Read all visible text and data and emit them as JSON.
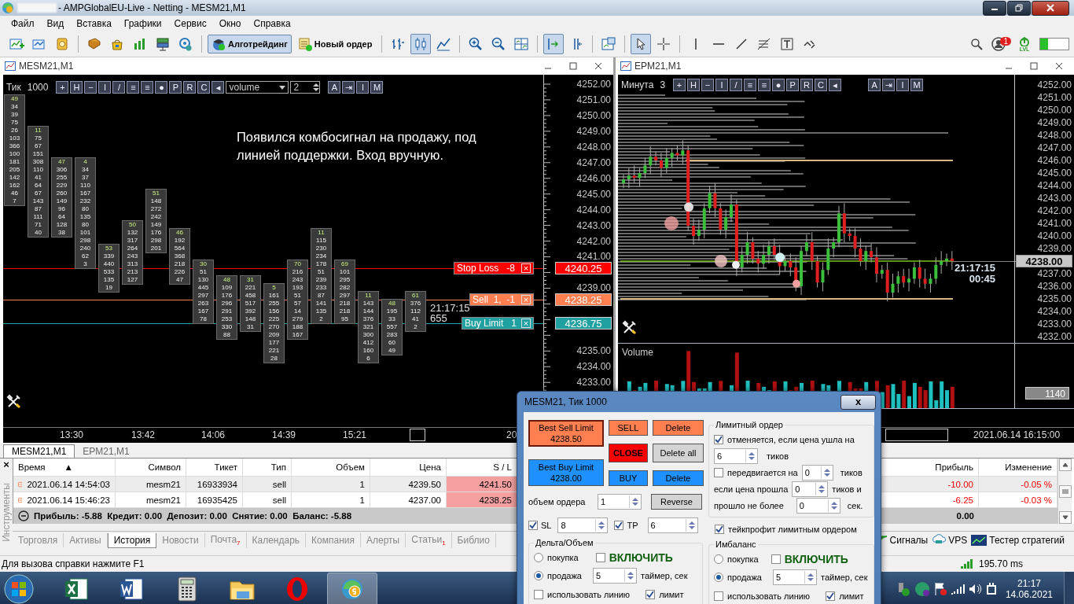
{
  "window": {
    "title": "- AMPGlobalEU-Live - Netting - MESM21,M1"
  },
  "menu": [
    "Файл",
    "Вид",
    "Вставка",
    "Графики",
    "Сервис",
    "Окно",
    "Справка"
  ],
  "toolbar": [
    {
      "kind": "new-chart",
      "selected": false
    },
    {
      "kind": "profiles",
      "selected": false
    },
    {
      "kind": "money",
      "selected": false
    },
    {
      "kind": "sep"
    },
    {
      "kind": "library",
      "selected": false
    },
    {
      "kind": "market",
      "selected": false
    },
    {
      "kind": "signals",
      "selected": false
    },
    {
      "kind": "server",
      "selected": false
    },
    {
      "kind": "radar",
      "selected": false
    },
    {
      "kind": "sep"
    },
    {
      "kind": "algo",
      "label": "Алготрейдинг",
      "selected": true
    },
    {
      "kind": "order",
      "label": "Новый ордер",
      "selected": false
    },
    {
      "kind": "sep"
    },
    {
      "kind": "bars",
      "selected": false
    },
    {
      "kind": "candles",
      "selected": true
    },
    {
      "kind": "line",
      "selected": false
    },
    {
      "kind": "sep"
    },
    {
      "kind": "zoom-in",
      "selected": false
    },
    {
      "kind": "zoom-out",
      "selected": false
    },
    {
      "kind": "tile",
      "selected": false
    },
    {
      "kind": "sep"
    },
    {
      "kind": "autoscroll",
      "selected": true
    },
    {
      "kind": "shift",
      "selected": false
    },
    {
      "kind": "sep"
    },
    {
      "kind": "template",
      "selected": false
    },
    {
      "kind": "sep"
    },
    {
      "kind": "cursor",
      "selected": true
    },
    {
      "kind": "crosshair",
      "selected": false
    },
    {
      "kind": "sep"
    },
    {
      "kind": "vline",
      "selected": false
    },
    {
      "kind": "hline",
      "selected": false
    },
    {
      "kind": "trend",
      "selected": false
    },
    {
      "kind": "fibo",
      "selected": false
    },
    {
      "kind": "text",
      "selected": false
    },
    {
      "kind": "shapes",
      "selected": false
    }
  ],
  "toolbar_right": {
    "badge": "1",
    "lvl": "LVL"
  },
  "left_chart": {
    "title": "MESM21,M1",
    "period": "Тик",
    "period_value": "1000",
    "tools": [
      "+",
      "H",
      "−",
      "I",
      "/",
      "≡",
      "≡",
      "●",
      "P",
      "R",
      "C",
      "◂"
    ],
    "indicator": "volume",
    "indicator_value": "2",
    "tools2": [
      "A",
      "⇥",
      "I",
      "M"
    ],
    "annotation": "Появился комбосигнал на продажу, под линией поддержки. Вход вручную.",
    "prices": [
      "4252.00",
      "4251.00",
      "4250.00",
      "4249.00",
      "4248.00",
      "4247.00",
      "4246.00",
      "4245.00",
      "4244.00",
      "4243.00",
      "4242.00",
      "4241.00",
      "4239.00",
      "4235.00",
      "4234.00",
      "4233.00"
    ],
    "clusters": [
      [
        "49",
        "34",
        "39",
        "75",
        "26",
        "103",
        "366",
        "100",
        "181",
        "205",
        "142",
        "162",
        "46",
        "7"
      ],
      [
        "11",
        "75",
        "67",
        "151",
        "308",
        "110",
        "41",
        "64",
        "67",
        "143",
        "87",
        "111",
        "71",
        "40"
      ],
      [
        "47",
        "306",
        "255",
        "229",
        "260",
        "149",
        "96",
        "64",
        "128",
        "38"
      ],
      [
        "4",
        "34",
        "37",
        "110",
        "167",
        "232",
        "80",
        "135",
        "80",
        "101",
        "298",
        "240",
        "62",
        "3"
      ],
      [
        "53",
        "339",
        "440",
        "533",
        "135",
        "19"
      ],
      [
        "50",
        "132",
        "317",
        "264",
        "243",
        "313",
        "213",
        "127"
      ],
      [
        "51",
        "148",
        "272",
        "242",
        "149",
        "176",
        "298",
        "201"
      ],
      [
        "46",
        "192",
        "564",
        "368",
        "218",
        "226",
        "47"
      ],
      [
        "30",
        "51",
        "130",
        "445",
        "297",
        "263",
        "167",
        "78"
      ],
      [
        "48",
        "109",
        "176",
        "296",
        "291",
        "253",
        "330",
        "88"
      ],
      [
        "31",
        "221",
        "458",
        "517",
        "392",
        "148",
        "31"
      ],
      [
        "5",
        "161",
        "255",
        "156",
        "225",
        "270",
        "209",
        "177",
        "221",
        "28"
      ],
      [
        "70",
        "216",
        "243",
        "193",
        "51",
        "57",
        "14",
        "279",
        "188",
        "167"
      ],
      [
        "11",
        "115",
        "230",
        "234",
        "178",
        "51",
        "239",
        "233",
        "87",
        "141",
        "135",
        "2"
      ],
      [
        "69",
        "101",
        "295",
        "282",
        "297",
        "218",
        "218",
        "95"
      ],
      [
        "11",
        "143",
        "144",
        "376",
        "321",
        "300",
        "412",
        "160",
        "6"
      ],
      [
        "48",
        "195",
        "33",
        "557",
        "283",
        "60",
        "49"
      ],
      [
        "61",
        "376",
        "112",
        "41",
        "2"
      ]
    ],
    "orders": [
      {
        "kind": "stop",
        "label": "Stop Loss   -8",
        "close": "×",
        "price": "4240.25",
        "color": "#ff0000"
      },
      {
        "kind": "position",
        "label": "Sell  1,  -1",
        "close": "×",
        "price": "4238.25",
        "color": "#ff7f50"
      },
      {
        "kind": "limit",
        "label": "Buy Limit   1",
        "close": "×",
        "price": "4236.75",
        "color": "#20a0a0"
      }
    ],
    "timer": "21:17:15",
    "timer_value": "655",
    "time_labels": [
      "13:30",
      "13:42",
      "14:06",
      "14:39",
      "15:21",
      "20"
    ]
  },
  "right_chart": {
    "title": "EPM21,M1",
    "period": "Минута",
    "period_value": "3",
    "tools": [
      "+",
      "H",
      "−",
      "I",
      "/",
      "≡",
      "≡",
      "●",
      "P",
      "R",
      "C",
      "◂"
    ],
    "tools2": [
      "A",
      "⇥",
      "I",
      "M"
    ],
    "prices": [
      "4252.00",
      "4251.00",
      "4250.00",
      "4249.00",
      "4248.00",
      "4247.00",
      "4246.00",
      "4245.00",
      "4244.00",
      "4243.00",
      "4242.00",
      "4241.00",
      "4240.00",
      "4239.00",
      "4237.00",
      "4236.00",
      "4235.00",
      "4234.00",
      "4233.00",
      "4232.00"
    ],
    "current": "4238.00",
    "timer": "21:17:15",
    "timer_value": "00:45",
    "volume_title": "Volume",
    "volume_value": "1140",
    "time_label": "2021.06.14 16:15:00"
  },
  "chart_tabs": [
    {
      "label": "MESM21,M1",
      "selected": true
    },
    {
      "label": "EPM21,M1",
      "selected": false
    }
  ],
  "toolbox": {
    "close": "×",
    "side_label": "Инструменты",
    "sort": "▲",
    "columns": [
      {
        "label": "Время",
        "kind": "text"
      },
      {
        "label": "Символ",
        "kind": "text"
      },
      {
        "label": "Тикет",
        "kind": "text"
      },
      {
        "label": "Тип",
        "kind": "text"
      },
      {
        "label": "Объем",
        "kind": "text"
      },
      {
        "label": "Цена",
        "kind": "text"
      },
      {
        "label": "S / L",
        "kind": "sl"
      },
      {
        "label": "Прибыль",
        "kind": "pnl"
      },
      {
        "label": "Изменение",
        "kind": "pnl"
      }
    ],
    "rows": [
      {
        "selected": true,
        "cells": [
          "2021.06.14 14:54:03",
          "mesm21",
          "16933934",
          "sell",
          "1",
          "4239.50",
          "4241.50",
          "-10.00",
          "-0.05 %"
        ]
      },
      {
        "selected": false,
        "cells": [
          "2021.06.14 15:46:23",
          "mesm21",
          "16935425",
          "sell",
          "1",
          "4237.00",
          "4238.25",
          "-6.25",
          "-0.03 %"
        ]
      }
    ],
    "summary": "Прибыль: -5.88  Кредит: 0.00  Депозит: 0.00  Снятие: 0.00  Баланс: -5.88",
    "summary_total": "0.00",
    "tabs": [
      {
        "label": "Торговля",
        "selected": false
      },
      {
        "label": "Активы",
        "selected": false
      },
      {
        "label": "История",
        "selected": true
      },
      {
        "label": "Новости",
        "selected": false
      },
      {
        "label": "Почта",
        "badge": "7",
        "selected": false
      },
      {
        "label": "Календарь",
        "selected": false
      },
      {
        "label": "Компания",
        "selected": false
      },
      {
        "label": "Алерты",
        "selected": false
      },
      {
        "label": "Статьи",
        "badge": "1",
        "selected": false
      },
      {
        "label": "Библио",
        "selected": false
      }
    ],
    "right_tabs": [
      {
        "kind": "signals",
        "label": "Сигналы"
      },
      {
        "kind": "vps",
        "label": "VPS"
      },
      {
        "kind": "tester",
        "label": "Тестер стратегий"
      }
    ]
  },
  "status_bar": {
    "help": "Для вызова справки нажмите F1",
    "ping": "195.70 ms"
  },
  "taskbar": {
    "apps": [
      {
        "kind": "excel",
        "selected": false
      },
      {
        "kind": "word",
        "selected": false
      },
      {
        "kind": "calculator",
        "selected": false
      },
      {
        "kind": "explorer",
        "selected": false
      },
      {
        "kind": "opera",
        "selected": false
      },
      {
        "kind": "terminal",
        "selected": true
      }
    ],
    "time": "21:17",
    "date": "14.06.2021"
  },
  "dialog": {
    "title": "MESM21, Тик  1000",
    "close": "x",
    "best": [
      {
        "label": "Best Sell Limit",
        "price": "4238.50",
        "color": "#ff7f50"
      },
      {
        "label": "Best Buy Limit",
        "price": "4238.00",
        "color": "#1e90ff"
      }
    ],
    "actions": [
      {
        "label": "SELL",
        "color": "#ff7f50"
      },
      {
        "label": "CLOSE",
        "color": "#ff0000"
      },
      {
        "label": "BUY",
        "color": "#1e90ff"
      }
    ],
    "deletes": [
      {
        "label": "Delete",
        "color": "#ff7f50"
      },
      {
        "label": "Delete all",
        "color": "#d4d4d4"
      },
      {
        "label": "Delete",
        "color": "#1e90ff"
      }
    ],
    "volume_label": "объем ордера",
    "volume": "1",
    "reverse": "Reverse",
    "sl": {
      "label": "SL",
      "checked": true,
      "value": "8"
    },
    "tp": {
      "label": "TP",
      "checked": true,
      "value": "6"
    },
    "limit_group": {
      "title": "Лимитный ордер",
      "cancel": {
        "label": "отменяется, если цена ушла на",
        "checked": true,
        "value": "6",
        "unit": "тиков"
      },
      "move": {
        "label": "передвигается на",
        "checked": false,
        "value": "0",
        "unit": "тиков"
      },
      "passed": {
        "label": "если цена прошла",
        "value": "0",
        "unit": "тиков и"
      },
      "time": {
        "label": "прошло не более",
        "value": "0",
        "unit": "сек."
      }
    },
    "tp_limit": {
      "label": "тейкпрофит лимитным ордером",
      "checked": true
    },
    "groups": [
      {
        "title": "Дельта/Объем",
        "buy": {
          "label": "покупка",
          "selected": false
        },
        "enable": {
          "label": "ВКЛЮЧИТЬ",
          "checked": false
        },
        "sell": {
          "label": "продажа",
          "selected": true
        },
        "timer": "5",
        "timer_label": "таймер, сек",
        "line": {
          "label": "использовать линию",
          "checked": false
        },
        "limit": {
          "label": "лимит",
          "checked": true
        }
      },
      {
        "title": "Имбаланс",
        "buy": {
          "label": "покупка",
          "selected": false
        },
        "enable": {
          "label": "ВКЛЮЧИТЬ",
          "checked": false
        },
        "sell": {
          "label": "продажа",
          "selected": true
        },
        "timer": "5",
        "timer_label": "таймер, сек",
        "line": {
          "label": "использовать линию",
          "checked": false
        },
        "limit": {
          "label": "лимит",
          "checked": true
        }
      }
    ]
  }
}
